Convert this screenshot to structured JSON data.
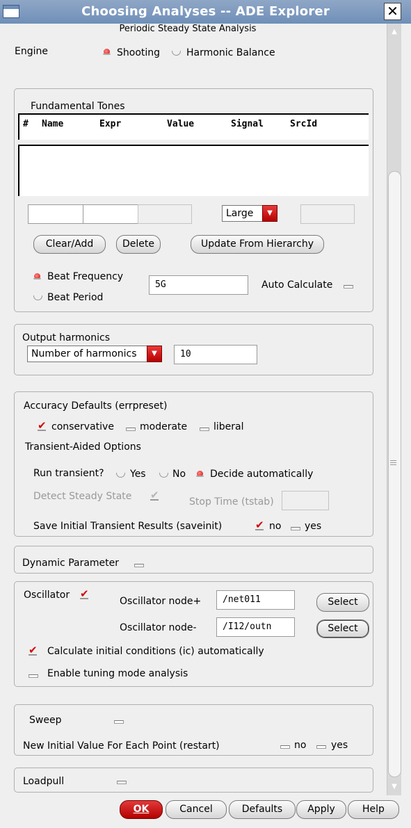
{
  "window": {
    "title": "Choosing Analyses -- ADE Explorer",
    "close_symbol": "✕"
  },
  "header": {
    "subtitle": "Periodic Steady State Analysis"
  },
  "engine": {
    "label": "Engine",
    "options": [
      "Shooting",
      "Harmonic Balance"
    ],
    "selected": "Shooting"
  },
  "fundamental_tones": {
    "title": "Fundamental Tones",
    "columns": [
      "#",
      "Name",
      "Expr",
      "Value",
      "Signal",
      "SrcId"
    ],
    "rows": [],
    "signal_combo": "Large",
    "buttons": {
      "clear_add": "Clear/Add",
      "delete": "Delete",
      "update": "Update From Hierarchy"
    },
    "beat_frequency_label": "Beat Frequency",
    "beat_period_label": "Beat Period",
    "beat_selected": "Beat Frequency",
    "beat_value": "5G",
    "auto_calculate_label": "Auto Calculate",
    "auto_calculate_checked": false
  },
  "output_harmonics": {
    "label": "Output harmonics",
    "combo": "Number of harmonics",
    "value": "10"
  },
  "accuracy": {
    "label": "Accuracy Defaults (errpreset)",
    "options": [
      "conservative",
      "moderate",
      "liberal"
    ],
    "selected": "conservative",
    "transient_title": "Transient-Aided Options",
    "run_transient_label": "Run transient?",
    "run_options": [
      "Yes",
      "No",
      "Decide automatically"
    ],
    "run_selected": "Decide automatically",
    "detect_label": "Detect Steady State",
    "stop_time_label": "Stop Time (tstab)",
    "save_init_label": "Save Initial Transient Results (saveinit)",
    "save_init_options": [
      "no",
      "yes"
    ],
    "save_init_selected": "no"
  },
  "dynamic_parameter": {
    "label": "Dynamic Parameter",
    "checked": false
  },
  "oscillator": {
    "label": "Oscillator",
    "checked": true,
    "node_plus_label": "Oscillator node+",
    "node_plus_value": "/net011",
    "node_minus_label": "Oscillator node-",
    "node_minus_value": "/I12/outn",
    "select_label": "Select",
    "calc_ic_label": "Calculate initial conditions (ic) automatically",
    "calc_ic_checked": true,
    "tuning_label": "Enable tuning mode analysis",
    "tuning_checked": false
  },
  "sweep": {
    "label": "Sweep",
    "checked": false,
    "restart_label": "New Initial Value For Each Point (restart)",
    "restart_options": [
      "no",
      "yes"
    ]
  },
  "loadpull": {
    "label": "Loadpull",
    "checked": false
  },
  "footer": {
    "ok": "OK",
    "cancel": "Cancel",
    "defaults": "Defaults",
    "apply": "Apply",
    "help": "Help"
  },
  "colors": {
    "titlebar": "#7f9bbf",
    "accent_red": "#d40000",
    "panel": "#efefef"
  }
}
